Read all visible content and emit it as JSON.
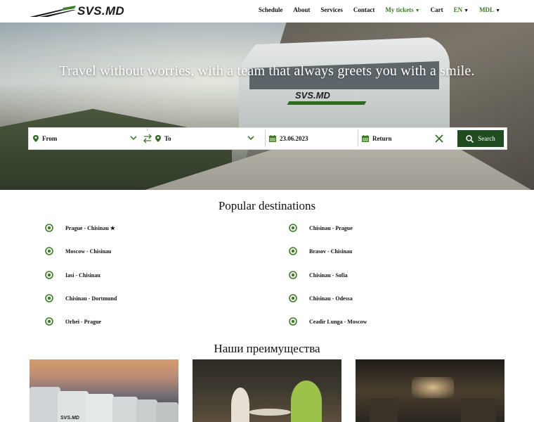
{
  "brand": {
    "name": "SVS.MD",
    "accent": "#3b7d23",
    "dark_green": "#1f4d20"
  },
  "nav": {
    "schedule": "Schedule",
    "about": "About",
    "services": "Services",
    "contact": "Contact",
    "my_tickets": "My tickets",
    "cart": "Cart",
    "language": "EN",
    "currency": "MDL"
  },
  "hero": {
    "title": "Travel without worries, with a team that always greets you with a smile.",
    "bus_logo": "SVS.MD"
  },
  "search": {
    "from_placeholder": "From",
    "to_placeholder": "To",
    "date_value": "23.06.2023",
    "return_placeholder": "Return",
    "search_label": "Search",
    "icons": {
      "pin": "map-pin-icon",
      "calendar": "calendar-icon",
      "swap": "swap-arrows-icon",
      "clear": "close-icon",
      "search": "search-icon"
    }
  },
  "popular": {
    "title": "Popular destinations",
    "left": [
      {
        "label": "Prague - Chisinau",
        "starred": true
      },
      {
        "label": "Moscow - Chisinau",
        "starred": false
      },
      {
        "label": "Iasi - Chisinau",
        "starred": false
      },
      {
        "label": "Chisinau - Dortmund",
        "starred": false
      },
      {
        "label": "Orhei - Prague",
        "starred": false
      }
    ],
    "right": [
      {
        "label": "Chisinau - Prague"
      },
      {
        "label": "Brasov - Chisinau"
      },
      {
        "label": "Chisinau - Sofia"
      },
      {
        "label": "Chisinau - Odessa"
      },
      {
        "label": "Ceadir Lunga - Moscow"
      }
    ]
  },
  "advantages": {
    "title": "Наши преимущества",
    "card1_bus_logo": "SVS.MD"
  }
}
